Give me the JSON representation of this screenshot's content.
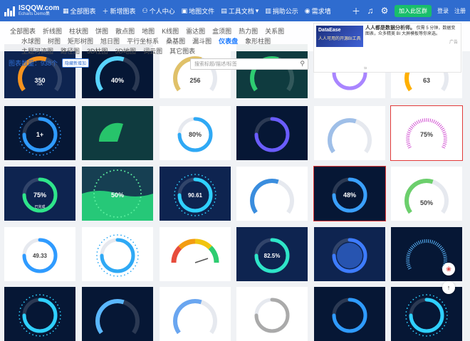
{
  "header": {
    "logo_title": "ISQQW.com",
    "logo_subtitle": "Echarts Demo集",
    "nav": [
      {
        "icon": "grid-icon",
        "label": "全部图表"
      },
      {
        "icon": "plus-icon",
        "label": "新增图表"
      },
      {
        "icon": "user-icon",
        "label": "个人中心"
      },
      {
        "icon": "map-icon",
        "label": "地图文件"
      },
      {
        "icon": "doc-icon",
        "label": "工具文档"
      },
      {
        "icon": "calendar-icon",
        "label": "捐助公示"
      },
      {
        "icon": "feedback-icon",
        "label": "需求墙"
      }
    ],
    "join_label": "加入此区群",
    "login_label": "登录",
    "register_label": "注册"
  },
  "filters": {
    "row1": [
      "全部图表",
      "折线图",
      "柱状图",
      "饼图",
      "散点图",
      "地图",
      "K线图",
      "雷达图",
      "盒须图",
      "热力图",
      "关系图"
    ],
    "row2": [
      "水球图",
      "树图",
      "矩形树图",
      "旭日图",
      "平行坐标系",
      "桑基图",
      "漏斗图",
      "仪表盘",
      "象形柱图"
    ],
    "row3": [
      "主题河流图",
      "路径图",
      "3D柱图",
      "3D地图",
      "词云图",
      "其它图表"
    ],
    "active": "仪表盘"
  },
  "toolbar": {
    "count_label": "图表数量：938个",
    "filter_button": "隐藏新增加",
    "search_placeholder": "搜索标题/描述/标签"
  },
  "ad": {
    "banner_title": "DataEase",
    "banner_sub": "人人可用的开源BI工具",
    "title": "人人都是数据分析师。",
    "desc": "仅需 5 分钟，数据变图表，众多精美 BI 大屏模板等你来选。",
    "corner": "广告",
    "footer": "ಙ"
  },
  "cards": [
    {
      "bg": "dark",
      "kind": "arc-partial",
      "color": "#f7931e",
      "value": "350",
      "hint": "mA"
    },
    {
      "bg": "darker",
      "kind": "arc-partial",
      "color": "#58d4ff",
      "value": "40%",
      "hint": ""
    },
    {
      "bg": "white",
      "kind": "arc-top",
      "color": "#e0c169",
      "value": "256",
      "hint": ""
    },
    {
      "bg": "teal",
      "kind": "arc-top",
      "color": "#2ecc71",
      "value": "",
      "hint": ""
    },
    {
      "bg": "white",
      "kind": "ring",
      "color": "#a985ff",
      "value": "",
      "hint": ""
    },
    {
      "bg": "white",
      "kind": "arc-top",
      "color": "#ffb000",
      "value": "63",
      "hint": ""
    },
    {
      "bg": "darker",
      "kind": "dots",
      "color": "#2f9bff",
      "value": "1+",
      "hint": ""
    },
    {
      "bg": "teal",
      "kind": "fan",
      "color": "#27c46b",
      "value": "",
      "hint": ""
    },
    {
      "bg": "white",
      "kind": "ring",
      "color": "#2fa9f5",
      "value": "80%",
      "hint": ""
    },
    {
      "bg": "darker",
      "kind": "ring",
      "color": "#6a5cff",
      "value": "",
      "hint": ""
    },
    {
      "bg": "white",
      "kind": "arc-top",
      "color": "#9fbfe8",
      "value": "",
      "hint": ""
    },
    {
      "bg": "white",
      "kind": "ticks",
      "color": "#d14fd1",
      "value": "75%",
      "hint": ""
    },
    {
      "bg": "dark",
      "kind": "ring",
      "color": "#2ee58a",
      "value": "75%",
      "hint": "已完成"
    },
    {
      "bg": "teal",
      "kind": "liquid",
      "color": "#26c878",
      "value": "50%",
      "hint": ""
    },
    {
      "bg": "dark",
      "kind": "dots",
      "color": "#2fd0ff",
      "value": "90.61",
      "hint": ""
    },
    {
      "bg": "white",
      "kind": "arc-top",
      "color": "#3a8dde",
      "value": "",
      "hint": ""
    },
    {
      "bg": "darker",
      "kind": "ring",
      "color": "#3aa0ff",
      "value": "48%",
      "hint": ""
    },
    {
      "bg": "white",
      "kind": "arc-top",
      "color": "#6ccf6c",
      "value": "50%",
      "hint": ""
    },
    {
      "bg": "white",
      "kind": "ring",
      "color": "#2f9bff",
      "value": "49.33",
      "hint": ""
    },
    {
      "bg": "white",
      "kind": "clock",
      "color": "#2fa9f5",
      "value": "",
      "hint": ""
    },
    {
      "bg": "white",
      "kind": "rainbow",
      "color": "#e74c3c",
      "value": "",
      "hint": ""
    },
    {
      "bg": "dark",
      "kind": "ring",
      "color": "#2ee5c8",
      "value": "82.5%",
      "hint": ""
    },
    {
      "bg": "dark",
      "kind": "glow",
      "color": "#3d7cff",
      "value": "",
      "hint": ""
    },
    {
      "bg": "darker",
      "kind": "ticks",
      "color": "#5ab7ff",
      "value": "",
      "hint": ""
    },
    {
      "bg": "darker",
      "kind": "dots",
      "color": "#2fd0ff",
      "value": "",
      "hint": ""
    },
    {
      "bg": "darker",
      "kind": "arc-top",
      "color": "#5ab7ff",
      "value": "",
      "hint": ""
    },
    {
      "bg": "white",
      "kind": "arc-top",
      "color": "#6aa6f0",
      "value": "",
      "hint": ""
    },
    {
      "bg": "white",
      "kind": "ring",
      "color": "#aaaaaa",
      "value": "",
      "hint": ""
    },
    {
      "bg": "darker",
      "kind": "ring",
      "color": "#2f9bff",
      "value": "",
      "hint": ""
    },
    {
      "bg": "darker",
      "kind": "dots",
      "color": "#2fd0ff",
      "value": "",
      "hint": ""
    }
  ],
  "float_buttons": {
    "feedback": "feedback-icon",
    "top": "arrow-up-icon"
  }
}
